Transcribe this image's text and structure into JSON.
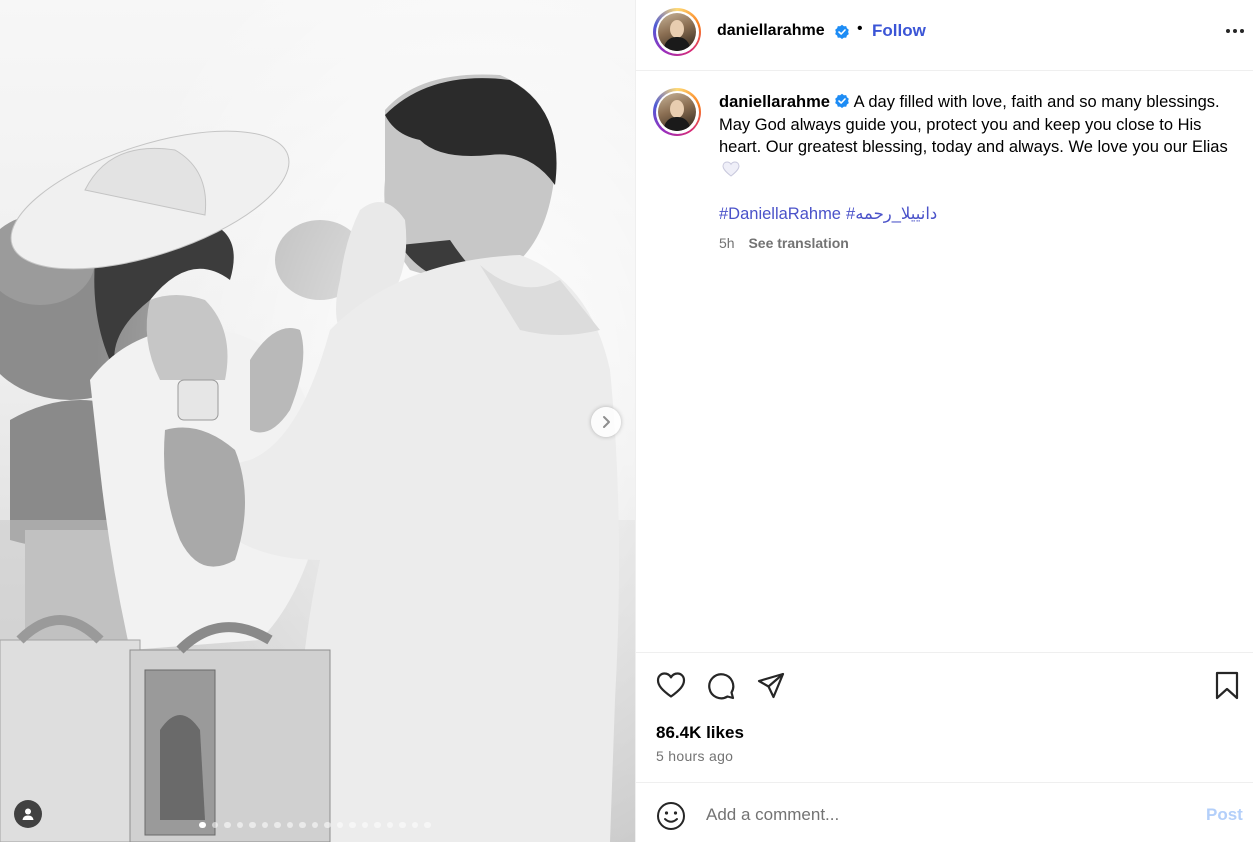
{
  "post": {
    "username": "daniellarahme",
    "verified_icon": "verified-badge-icon",
    "follow_label": "Follow",
    "separator": "•",
    "caption": "A day filled with love, faith and so many blessings. May God always guide you, protect you and keep you close to His heart. Our greatest blessing, today and always. We love you our Elias",
    "caption_emoji": "white-heart-icon",
    "hashtags": [
      "#DaniellaRahme",
      "#دانييلا_رحمه"
    ],
    "age_short": "5h",
    "see_translation": "See translation",
    "likes": "86.4K likes",
    "time_ago": "5 hours ago"
  },
  "media": {
    "image_count": 19,
    "active_index": 0,
    "next_icon": "chevron-right-icon",
    "tag_icon": "user-tag-icon"
  },
  "comment": {
    "placeholder": "Add a comment...",
    "post_label": "Post"
  },
  "colors": {
    "follow": "#3b55d6",
    "hashtag": "#4a52c9",
    "post_disabled": "#b3cffa",
    "muted": "#737373",
    "verified": "#1d8cf5"
  }
}
